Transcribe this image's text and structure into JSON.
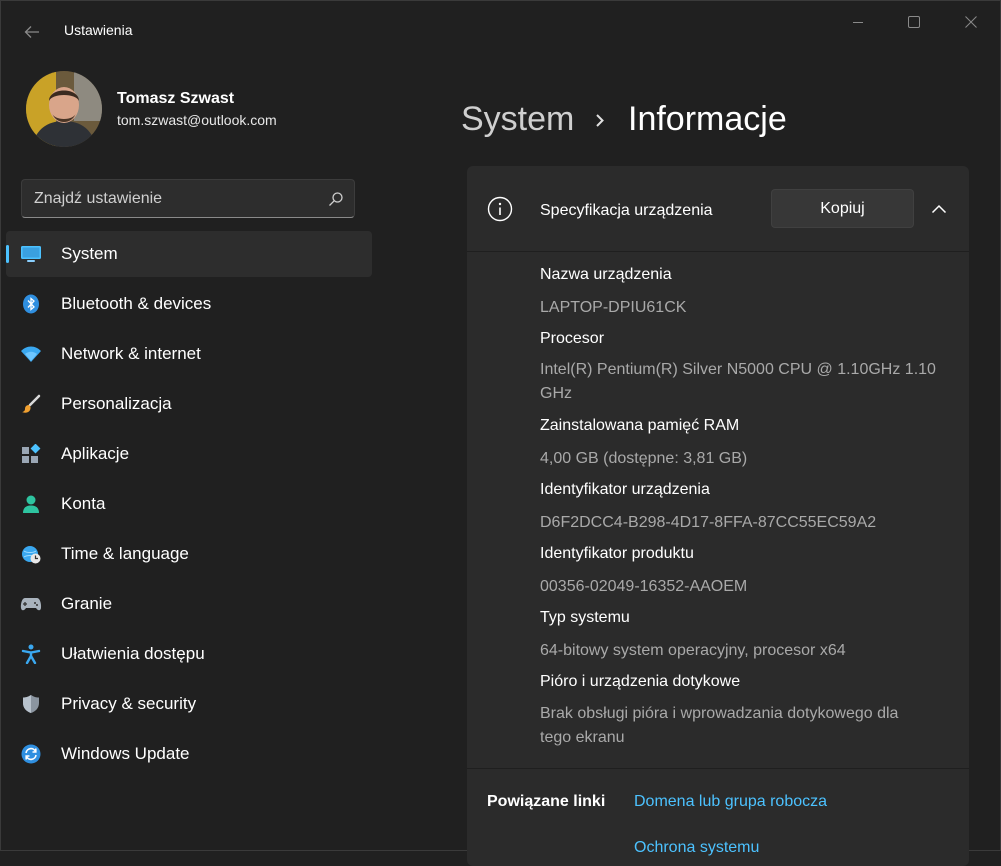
{
  "app": {
    "title": "Ustawienia"
  },
  "user": {
    "name": "Tomasz Szwast",
    "email": "tom.szwast@outlook.com"
  },
  "search": {
    "placeholder": "Znajdź ustawienie"
  },
  "nav": [
    {
      "label": "System",
      "icon": "system-monitor-icon",
      "active": true
    },
    {
      "label": "Bluetooth & devices",
      "icon": "bluetooth-icon"
    },
    {
      "label": "Network & internet",
      "icon": "wifi-icon"
    },
    {
      "label": "Personalizacja",
      "icon": "brush-icon"
    },
    {
      "label": "Aplikacje",
      "icon": "apps-icon"
    },
    {
      "label": "Konta",
      "icon": "person-icon"
    },
    {
      "label": "Time & language",
      "icon": "globe-clock-icon"
    },
    {
      "label": "Granie",
      "icon": "gamepad-icon"
    },
    {
      "label": "Ułatwienia dostępu",
      "icon": "accessibility-icon"
    },
    {
      "label": "Privacy & security",
      "icon": "shield-icon"
    },
    {
      "label": "Windows Update",
      "icon": "update-icon"
    }
  ],
  "header": {
    "parent": "System",
    "current": "Informacje"
  },
  "spec": {
    "title": "Specyfikacja urządzenia",
    "copy_label": "Kopiuj",
    "items": [
      {
        "label": "Nazwa urządzenia",
        "value": "LAPTOP-DPIU61CK"
      },
      {
        "label": "Procesor",
        "value": "Intel(R) Pentium(R) Silver N5000 CPU @ 1.10GHz 1.10 GHz"
      },
      {
        "label": "Zainstalowana pamięć RAM",
        "value": "4,00 GB (dostępne: 3,81 GB)"
      },
      {
        "label": "Identyfikator urządzenia",
        "value": "D6F2DCC4-B298-4D17-8FFA-87CC55EC59A2"
      },
      {
        "label": "Identyfikator produktu",
        "value": "00356-02049-16352-AAOEM"
      },
      {
        "label": "Typ systemu",
        "value": "64-bitowy system operacyjny, procesor x64"
      },
      {
        "label": "Pióro i urządzenia dotykowe",
        "value": "Brak obsługi pióra i wprowadzania dotykowego dla tego ekranu"
      }
    ]
  },
  "related": {
    "title": "Powiązane linki",
    "links": [
      "Domena lub grupa robocza",
      "Ochrona systemu"
    ]
  },
  "colors": {
    "accent": "#4cc2ff",
    "background": "#202020",
    "card": "#2b2b2b"
  }
}
